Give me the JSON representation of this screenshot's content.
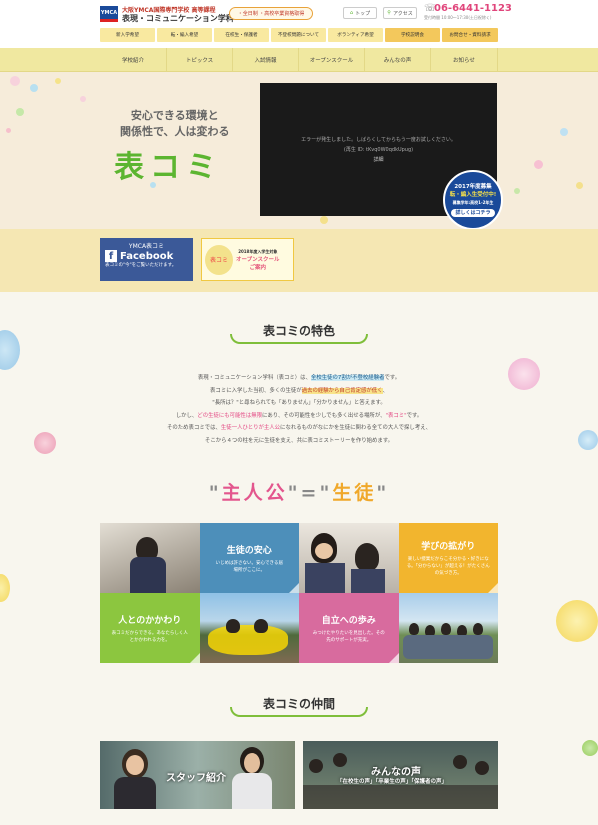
{
  "header": {
    "logo_text": "YMCA",
    "school_line1": "大阪YMCA国際専門学校 高等課程",
    "school_line2": "表現・コミュニケーション学科",
    "pill": "・全日制 ・高校卒業資格取得",
    "top_btn": "トップ",
    "access_btn": "アクセス",
    "phone": "06-6441-1123",
    "phone_hours": "受付時間 10:00〜17:30(土日祝除く)"
  },
  "subnav": [
    "新入学希望",
    "転・編入希望",
    "在校生・保護者",
    "不登校問題について",
    "ボランティア希望",
    "学校説明会",
    "お問合せ・資料請求"
  ],
  "nav": [
    "学校紹介",
    "トピックス",
    "入試情報",
    "オープンスクール",
    "みんなの声",
    "お知らせ"
  ],
  "hero": {
    "tagline1": "安心できる環境と",
    "tagline2": "関係性で、人は変わる",
    "title": "表コミ",
    "video_error1": "エラーが発生しました。しばらくしてからもう一度お試しください。",
    "video_error2": "(再生 ID: tKvq0W0qdkUpug)",
    "video_error3": "詳細",
    "seal_line1": "2017年度募集",
    "seal_line2": "転・編入生受付中!",
    "seal_line3": "募集学年:高校1-2年生",
    "seal_btn": "詳しくはコチラ"
  },
  "banners": {
    "fb_line1": "YMCA表コミ",
    "fb_line2": "Facebook",
    "fb_line3": "表コミの\"今\"をご覧いただけます。",
    "oc_pic": "表コミ",
    "oc_line1": "2018年度入学生対象",
    "oc_line2": "オープンスクール",
    "oc_line3": "ご案内"
  },
  "features": {
    "title": "表コミの特色",
    "p1a": "表現・コミュニケーション学科（表コミ）は、",
    "p1b": "全校生徒の7割が不登校経験者",
    "p1c": "です。",
    "p2a": "表コミに入学した当初、多くの生徒が",
    "p2b": "過去の経験から自己肯定感が低く",
    "p2c": "、",
    "p3": "\"長所は？\"と尋ねられても「ありません」「分かりません」と答えます。",
    "p4a": "しかし、",
    "p4b": "どの生徒にも可能性は無限",
    "p4c": "にあり、その可能性を少しでも多く出せる場所が、",
    "p4d": "\"表コミ\"",
    "p4e": "です。",
    "p5a": "そのため表コミでは、",
    "p5b": "生徒一人ひとりが主人公",
    "p5c": "になれるものがなにかを生徒に関わる全ての大人で探し考え、",
    "p6": "そこから４つの柱を元に生徒を支え、共に表コミストーリーを作り始めます。",
    "slogan_q1": "\"",
    "slogan_a": "主人公",
    "slogan_eq": "\"=\"",
    "slogan_b": "生徒",
    "slogan_q2": "\""
  },
  "tiles": [
    {
      "heading": "生徒の安心",
      "text": "いじめは許さない。安心できる居場所がここに。",
      "color": "#4d8fba"
    },
    {
      "heading": "学びの拡がり",
      "text": "楽しい授業だからこそ分かる・好きになる。「分からない」が超える！がたくさんの気づき方。",
      "color": "#f2b52e"
    },
    {
      "heading": "人とのかかわり",
      "text": "表コミだからできる。あなたらしく人とかかわれる力を。",
      "color": "#8cc63f"
    },
    {
      "heading": "自立への歩み",
      "text": "みつけたやりたいを見出した。その先のサポートが充実。",
      "color": "#d86b9e"
    }
  ],
  "members": {
    "title": "表コミの仲間",
    "staff": "スタッフ紹介",
    "voices": "みんなの声",
    "voices_sub": "「在校生の声」「卒業生の声」「保護者の声」"
  }
}
